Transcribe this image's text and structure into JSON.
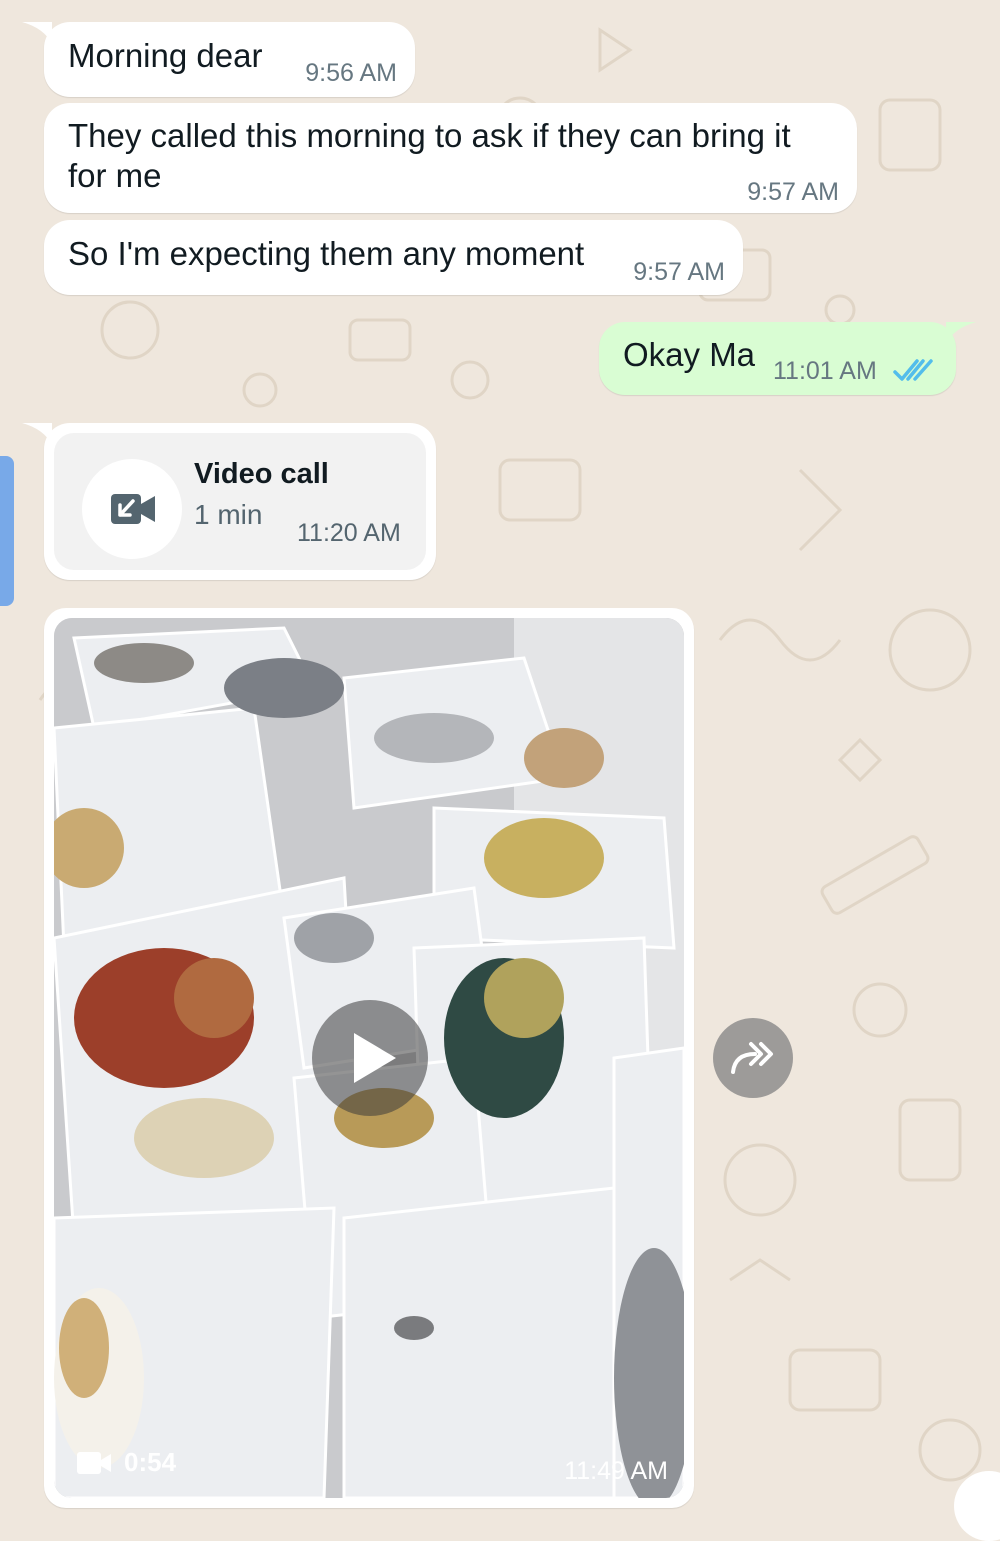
{
  "chat": {
    "messages": [
      {
        "text": "Morning dear",
        "time": "9:56 AM"
      },
      {
        "text": "They called this morning to ask if they can bring it for me",
        "time": "9:57 AM"
      },
      {
        "text": "So I'm expecting them any moment",
        "time": "9:57 AM"
      },
      {
        "text": "Okay Ma",
        "time": "11:01 AM",
        "status_icon": "double-check-read-icon"
      }
    ],
    "call": {
      "title": "Video call",
      "duration": "1 min",
      "time": "11:20 AM",
      "icon": "missed-video-call-icon"
    },
    "video": {
      "duration": "0:54",
      "time": "11:49 AM",
      "play_icon": "play-icon",
      "camera_icon": "video-camera-icon"
    },
    "forward_icon": "forward-icon"
  },
  "colors": {
    "wallpaper": "#efe7dd",
    "incoming_bubble": "#ffffff",
    "outgoing_bubble": "#d9fdd3",
    "read_ticks": "#53bdeb",
    "time_text": "#667781"
  }
}
